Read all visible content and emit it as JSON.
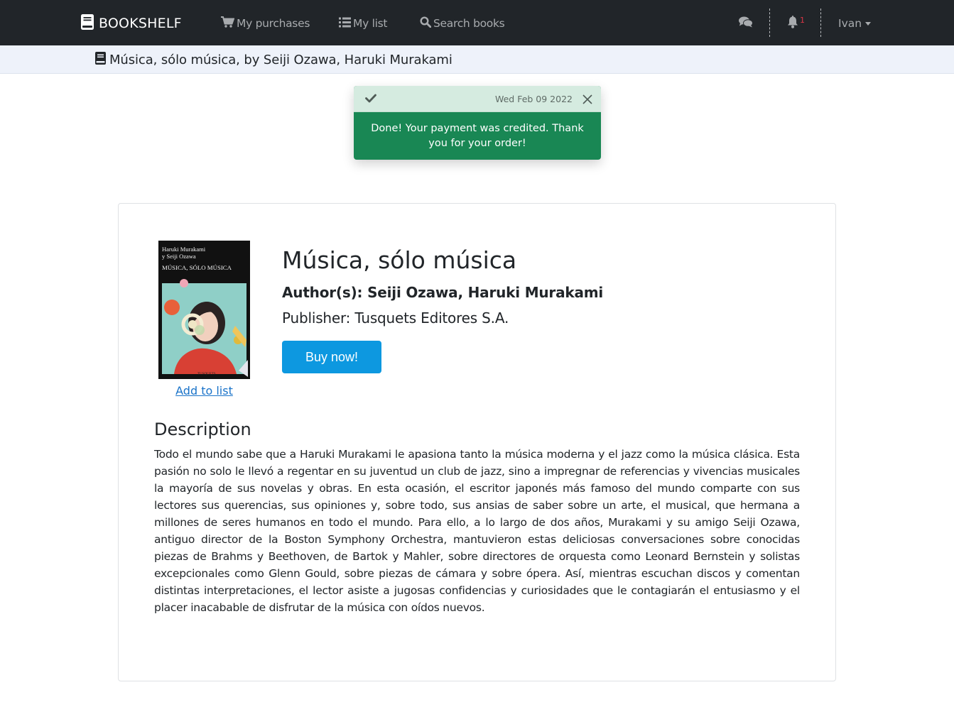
{
  "navbar": {
    "brand": "BOOKSHELF",
    "links": [
      {
        "label": "My purchases",
        "icon": "cart-icon"
      },
      {
        "label": "My list",
        "icon": "list-icon"
      },
      {
        "label": "Search books",
        "icon": "search-icon"
      }
    ],
    "notification_count": "1",
    "user": "Ivan"
  },
  "breadcrumb": {
    "text": "Música, sólo música, by Seiji Ozawa, Haruki Murakami",
    "icon": "book-icon"
  },
  "toast": {
    "time": "Wed Feb 09 2022",
    "message": "Done! Your payment was credited. Thank you for your order!",
    "status_color": "#198754"
  },
  "book": {
    "cover": {
      "authors_line1": "Haruki Murakami",
      "authors_line2": "y Seiji Ozawa",
      "title": "MÚSICA, SÓLO MÚSICA",
      "publisher_mark": "TUSQUETS"
    },
    "add_to_list_label": "Add to list",
    "title": "Música, sólo música",
    "authors": "Author(s): Seiji Ozawa, Haruki Murakami",
    "publisher": "Publisher: Tusquets Editores S.A.",
    "buy_label": "Buy now!",
    "description_heading": "Description",
    "description": "Todo el mundo sabe que a Haruki Murakami le apasiona tanto la música moderna y el jazz como la música clásica. Esta pasión no solo le llevó a regentar en su juventud un club de jazz, sino a impregnar de referencias y vivencias musicales la mayoría de sus novelas y obras. En esta ocasión, el escritor japonés más famoso del mundo comparte con sus lectores sus querencias, sus opiniones y, sobre todo, sus ansias de saber sobre un arte, el musical, que hermana a millones de seres humanos en todo el mundo. Para ello, a lo largo de dos años, Murakami y su amigo Seiji Ozawa, antiguo director de la Boston Symphony Orchestra, mantuvieron estas deliciosas conversaciones sobre conocidas piezas de Brahms y Beethoven, de Bartok y Mahler, sobre directores de orquesta como Leonard Bernstein y solistas excepcionales como Glenn Gould, sobre piezas de cámara y sobre ópera. Así, mientras escuchan discos y comentan distintas interpretaciones, el lector asiste a jugosas confidencias y curiosidades que le contagiarán el entusiasmo y el placer inacabable de disfrutar de la música con oídos nuevos."
  },
  "colors": {
    "navbar_bg": "#212529",
    "primary_button": "#0d98e0",
    "link": "#1a73c9",
    "badge": "#dc3545"
  }
}
